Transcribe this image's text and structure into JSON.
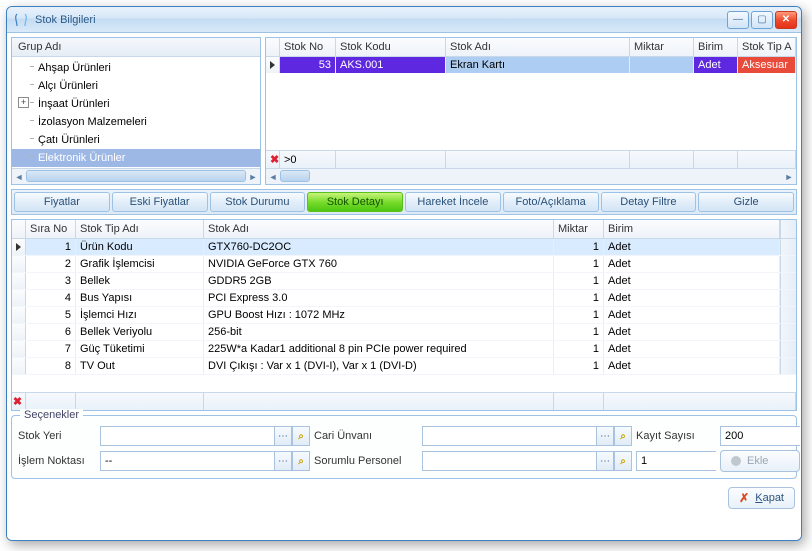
{
  "window": {
    "title": "Stok Bilgileri"
  },
  "tree": {
    "header": "Grup Adı",
    "items": [
      {
        "label": "Ahşap Ürünleri",
        "hasChildren": false
      },
      {
        "label": "Alçı Ürünleri",
        "hasChildren": false
      },
      {
        "label": "İnşaat Ürünleri",
        "hasChildren": true
      },
      {
        "label": "İzolasyon Malzemeleri",
        "hasChildren": false
      },
      {
        "label": "Çatı Ürünleri",
        "hasChildren": false
      },
      {
        "label": "Elektronik Ürünler",
        "hasChildren": false,
        "selected": true
      }
    ]
  },
  "upper_grid": {
    "columns": [
      "Stok No",
      "Stok Kodu",
      "Stok Adı",
      "Miktar",
      "Birim",
      "Stok Tip A"
    ],
    "rows": [
      {
        "stok_no": "53",
        "stok_kodu": "AKS.001",
        "stok_adi": "Ekran Kartı",
        "miktar": "",
        "birim": "Adet",
        "stok_tip": "Aksesuar"
      }
    ],
    "footer_filter": ">0"
  },
  "tabs": [
    "Fiyatlar",
    "Eski Fiyatlar",
    "Stok Durumu",
    "Stok Detayı",
    "Hareket İncele",
    "Foto/Açıklama",
    "Detay Filtre",
    "Gizle"
  ],
  "active_tab_index": 3,
  "detail_grid": {
    "columns": [
      "Sıra No",
      "Stok Tip Adı",
      "Stok Adı",
      "Miktar",
      "Birim"
    ],
    "rows": [
      {
        "sira": "1",
        "tip": "Ürün Kodu",
        "adi": "GTX760-DC2OC",
        "miktar": "1",
        "birim": "Adet",
        "selected": true
      },
      {
        "sira": "2",
        "tip": "Grafik İşlemcisi",
        "adi": "NVIDIA GeForce GTX 760",
        "miktar": "1",
        "birim": "Adet"
      },
      {
        "sira": "3",
        "tip": "Bellek",
        "adi": "GDDR5 2GB",
        "miktar": "1",
        "birim": "Adet"
      },
      {
        "sira": "4",
        "tip": "Bus Yapısı",
        "adi": "PCI Express 3.0",
        "miktar": "1",
        "birim": "Adet"
      },
      {
        "sira": "5",
        "tip": "İşlemci Hızı",
        "adi": "GPU Boost Hızı : 1072 MHz",
        "miktar": "1",
        "birim": "Adet"
      },
      {
        "sira": "6",
        "tip": "Bellek Veriyolu",
        "adi": "256-bit",
        "miktar": "1",
        "birim": "Adet"
      },
      {
        "sira": "7",
        "tip": "Güç Tüketimi",
        "adi": "225W*a Kadar1 additional 8 pin PCIe power required",
        "miktar": "1",
        "birim": "Adet"
      },
      {
        "sira": "8",
        "tip": "TV Out",
        "adi": "DVI Çıkışı : Var x 1 (DVI-I), Var x 1 (DVI-D)",
        "miktar": "1",
        "birim": "Adet"
      }
    ]
  },
  "options": {
    "legend": "Seçenekler",
    "labels": {
      "stok_yeri": "Stok Yeri",
      "islem_noktasi": "İşlem Noktası",
      "cari_unvani": "Cari Ünvanı",
      "sorumlu_personel": "Sorumlu Personel",
      "kayit_sayisi": "Kayıt Sayısı"
    },
    "values": {
      "stok_yeri": "",
      "islem_noktasi": "--",
      "cari_unvani": "",
      "sorumlu_personel": "",
      "kayit_sayisi": "200",
      "page": "1"
    },
    "ekle_label": "Ekle"
  },
  "footer": {
    "close_prefix": "K",
    "close_rest": "apat"
  }
}
